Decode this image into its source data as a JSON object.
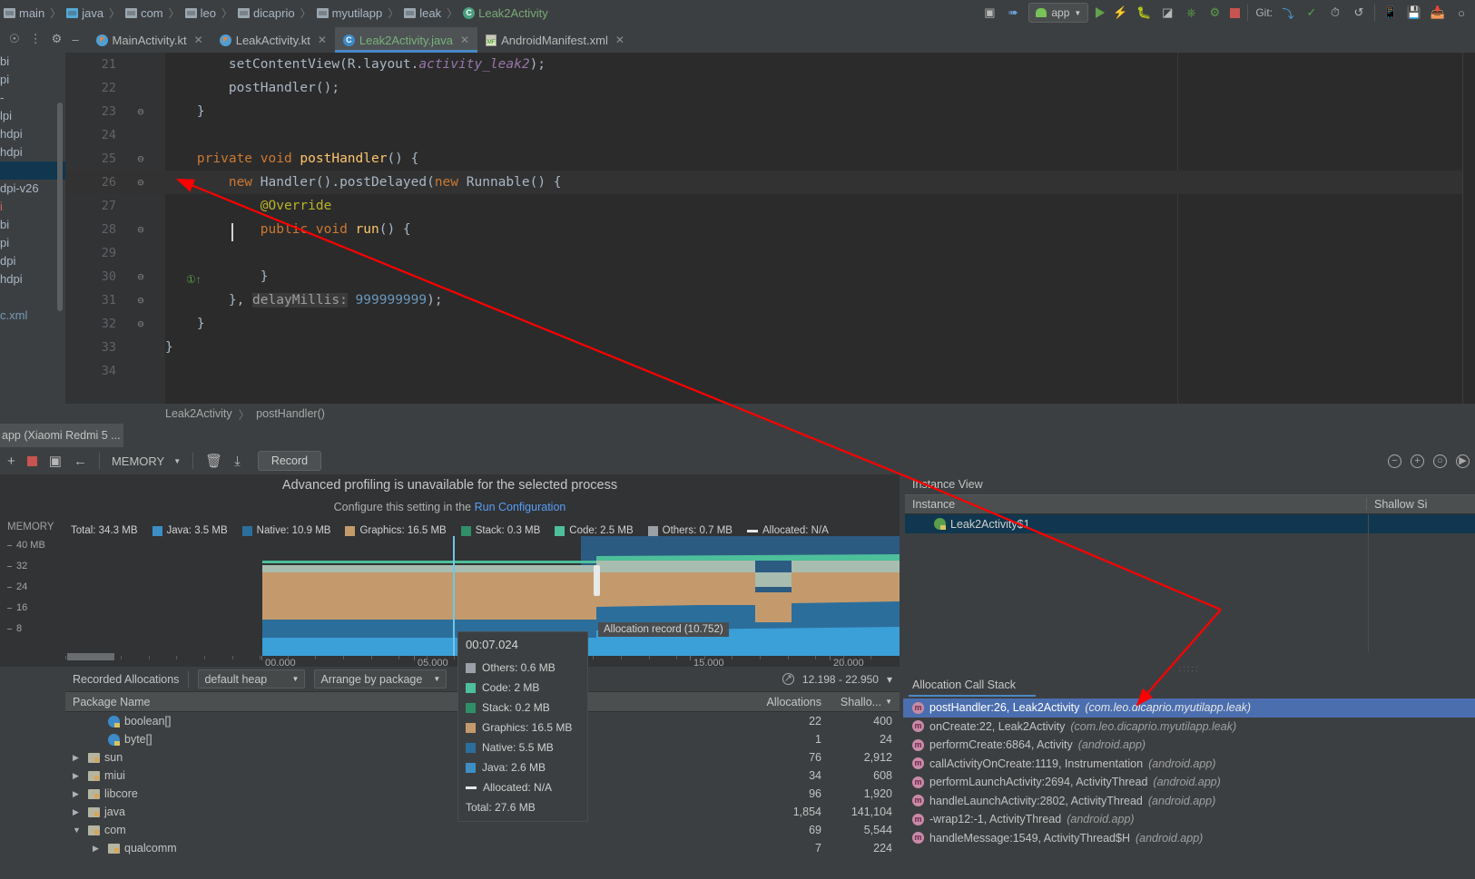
{
  "breadcrumb": {
    "items": [
      {
        "label": "main",
        "icon": "folder-icon"
      },
      {
        "label": "java",
        "icon": "folder-blue-icon"
      },
      {
        "label": "com",
        "icon": "folder-icon"
      },
      {
        "label": "leo",
        "icon": "folder-icon"
      },
      {
        "label": "dicaprio",
        "icon": "folder-icon"
      },
      {
        "label": "myutilapp",
        "icon": "folder-icon"
      },
      {
        "label": "leak",
        "icon": "folder-icon"
      },
      {
        "label": "Leak2Activity",
        "icon": "class-icon"
      }
    ],
    "separator": "〉"
  },
  "top_toolbar": {
    "app_config": "app",
    "git_label": "Git:",
    "icons": [
      "open-tool-window-icon",
      "build-hammer-icon",
      "run-icon",
      "apply-changes-icon",
      "debug-icon",
      "attach-debugger-icon",
      "profile-icon",
      "run-with-coverage-icon",
      "stop-icon",
      "update-project-icon",
      "commit-icon",
      "history-icon",
      "undo-icon",
      "avd-manager-icon",
      "sdk-manager-icon",
      "device-file-explorer-icon",
      "search-icon"
    ]
  },
  "editor_tabs": [
    {
      "label": "MainActivity.kt",
      "icon": "kotlin-file-icon",
      "active": false
    },
    {
      "label": "LeakActivity.kt",
      "icon": "kotlin-file-icon",
      "active": false
    },
    {
      "label": "Leak2Activity.java",
      "icon": "java-class-icon",
      "active": true
    },
    {
      "label": "AndroidManifest.xml",
      "icon": "manifest-file-icon",
      "active": false
    }
  ],
  "project_strip": {
    "rows": [
      "bi",
      "pi",
      "-",
      "lpi",
      "hdpi",
      "hdpi",
      "",
      "dpi-v26",
      "i",
      "bi",
      "pi",
      "dpi",
      "hdpi",
      "",
      "c.xml"
    ],
    "selected_index": 6
  },
  "code": {
    "lines": [
      {
        "num": "21",
        "fold": "",
        "html": "        <span class=\"txt\">setContentView(R.</span><span class=\"txt\">layout.</span><span class=\"fld\">activity_leak2</span><span class=\"txt\">);</span>"
      },
      {
        "num": "22",
        "fold": "",
        "html": "        <span class=\"txt\">postHandler();</span>"
      },
      {
        "num": "23",
        "fold": "⊖",
        "html": "    <span class=\"txt\">}</span>"
      },
      {
        "num": "24",
        "fold": "",
        "html": ""
      },
      {
        "num": "25",
        "fold": "⊖",
        "html": "    <span class=\"kw\">private void </span><span class=\"fn\">postHandler</span><span class=\"txt\">() {</span>"
      },
      {
        "num": "26",
        "fold": "⊖",
        "html": "        <span class=\"kw\">new </span><span class=\"txt\">Handler().postDelayed(</span><span class=\"kw\">new </span><span class=\"txt\">Runnable() {</span>",
        "current": true
      },
      {
        "num": "27",
        "fold": "",
        "html": "            <span class=\"ann\">@Override</span>"
      },
      {
        "num": "28",
        "fold": "⊖",
        "html": "            <span class=\"kw\">public void </span><span class=\"fn\">run</span><span class=\"txt\">() {</span>"
      },
      {
        "num": "29",
        "fold": "",
        "html": ""
      },
      {
        "num": "30",
        "fold": "⊖",
        "html": "            <span class=\"txt\">}</span>"
      },
      {
        "num": "31",
        "fold": "⊖",
        "html": "        <span class=\"txt\">}, </span><span class=\"param\">delayMillis:</span><span class=\"txt\"> </span><span class=\"num\">999999999</span><span class=\"txt\">);</span>"
      },
      {
        "num": "32",
        "fold": "⊖",
        "html": "    <span class=\"txt\">}</span>"
      },
      {
        "num": "33",
        "fold": "",
        "html": "<span class=\"txt\">}</span>"
      },
      {
        "num": "34",
        "fold": "",
        "html": ""
      }
    ]
  },
  "editor_breadcrumb": {
    "class": "Leak2Activity",
    "method": "postHandler()",
    "separator": "〉"
  },
  "profiler": {
    "process_tab": "app (Xiaomi Redmi 5 ...",
    "back_icon": "back-arrow-icon",
    "mode": "MEMORY",
    "record_button": "Record",
    "trash_icon": "trash-icon",
    "export_icon": "export-capture-icon",
    "add_icon": "add-icon",
    "stop_icon": "stop-icon",
    "window_icon": "split-icon",
    "zoom_out_icon": "zoom-out-icon",
    "zoom_in_icon": "zoom-in-icon",
    "reset_zoom_icon": "reset-zoom-icon",
    "attach-live-icon": "attach-to-live-icon"
  },
  "memory": {
    "advanced_message": "Advanced profiling is unavailable for the selected process",
    "configure_prefix": "Configure this setting in the ",
    "configure_link": "Run Configuration",
    "axis_title": "MEMORY",
    "legend": [
      {
        "label": "Total: 34.3 MB",
        "color": "",
        "type": "text"
      },
      {
        "label": "Java: 3.5 MB",
        "color": "#3b8fc4",
        "type": "swatch"
      },
      {
        "label": "Native: 10.9 MB",
        "color": "#2c6e9b",
        "type": "swatch"
      },
      {
        "label": "Graphics: 16.5 MB",
        "color": "#c49a6c",
        "type": "swatch"
      },
      {
        "label": "Stack: 0.3 MB",
        "color": "#2f8f68",
        "type": "swatch"
      },
      {
        "label": "Code: 2.5 MB",
        "color": "#4dbf9a",
        "type": "swatch"
      },
      {
        "label": "Others: 0.7 MB",
        "color": "#9aa0a6",
        "type": "swatch"
      },
      {
        "label": "Allocated: N/A",
        "color": "#e6e6e6",
        "type": "dash"
      }
    ],
    "allocation_record": "Allocation record (10.752)"
  },
  "chart_data": {
    "type": "area",
    "title": "MEMORY",
    "ylabel": "MB",
    "xlabel": "",
    "ylim": [
      0,
      44
    ],
    "yticks": [
      "40 MB",
      "32",
      "24",
      "16",
      "8"
    ],
    "ytick_values": [
      40,
      32,
      24,
      16,
      8
    ],
    "xticks": [
      "00.000",
      "05.000",
      "15.000",
      "20.000"
    ],
    "xtick_values": [
      0,
      5,
      15,
      20
    ],
    "xlim": [
      -1.5,
      22.95
    ],
    "grid": false,
    "legend_position": "top",
    "series": [
      {
        "name": "Java",
        "color": "#3b8fc4",
        "value_mb": 3.5
      },
      {
        "name": "Native",
        "color": "#2c6e9b",
        "value_mb": 10.9
      },
      {
        "name": "Graphics",
        "color": "#c49a6c",
        "value_mb": 16.5
      },
      {
        "name": "Stack",
        "color": "#2f8f68",
        "value_mb": 0.3
      },
      {
        "name": "Code",
        "color": "#4dbf9a",
        "value_mb": 2.5
      },
      {
        "name": "Others",
        "color": "#9aa0a6",
        "value_mb": 0.7
      },
      {
        "name": "Allocated",
        "color": "#e6e6e6",
        "value_mb": null
      }
    ],
    "total_mb": 34.3,
    "selection_range": "12.198 - 22.950",
    "hover_point": {
      "time": "00:07.024",
      "values": [
        {
          "name": "Others",
          "value": "0.6 MB",
          "color": "#9aa0a6"
        },
        {
          "name": "Code",
          "value": "2 MB",
          "color": "#4dbf9a"
        },
        {
          "name": "Stack",
          "value": "0.2 MB",
          "color": "#2f8f68"
        },
        {
          "name": "Graphics",
          "value": "16.5 MB",
          "color": "#c49a6c"
        },
        {
          "name": "Native",
          "value": "5.5 MB",
          "color": "#2c6e9b"
        },
        {
          "name": "Java",
          "value": "2.6 MB",
          "color": "#3b8fc4"
        },
        {
          "name": "Allocated",
          "value": "N/A",
          "color": "#e6e6e6"
        }
      ],
      "total": "Total: 27.6 MB"
    }
  },
  "tooltip": {
    "time": "00:07.024",
    "rows": [
      {
        "label": "Others: 0.6 MB",
        "color": "#9aa0a6",
        "type": "swatch"
      },
      {
        "label": "Code: 2 MB",
        "color": "#4dbf9a",
        "type": "swatch"
      },
      {
        "label": "Stack: 0.2 MB",
        "color": "#2f8f68",
        "type": "swatch"
      },
      {
        "label": "Graphics: 16.5 MB",
        "color": "#c49a6c",
        "type": "swatch"
      },
      {
        "label": "Native: 5.5 MB",
        "color": "#2c6e9b",
        "type": "swatch"
      },
      {
        "label": "Java: 2.6 MB",
        "color": "#3b8fc4",
        "type": "swatch"
      },
      {
        "label": "Allocated: N/A",
        "color": "#e6e6e6",
        "type": "dash"
      }
    ],
    "total": "Total: 27.6 MB"
  },
  "allocations": {
    "title": "Recorded Allocations",
    "heap_select": "default heap",
    "arrange_select": "Arrange by package",
    "time_range": "12.198 - 22.950",
    "clock_icon": "clock-icon",
    "filter_icon": "filter-icon",
    "columns": [
      "Package Name",
      "Allocations",
      "Shallo..."
    ],
    "rows": [
      {
        "name": "boolean[]",
        "icon": "class-icon",
        "expand": "",
        "indent": true,
        "allocations": "22",
        "shallow": "400"
      },
      {
        "name": "byte[]",
        "icon": "class-icon",
        "expand": "",
        "indent": true,
        "allocations": "1",
        "shallow": "24"
      },
      {
        "name": "sun",
        "icon": "package-icon",
        "expand": "▶",
        "indent": false,
        "allocations": "76",
        "shallow": "2,912"
      },
      {
        "name": "miui",
        "icon": "package-icon",
        "expand": "▶",
        "indent": false,
        "allocations": "34",
        "shallow": "608"
      },
      {
        "name": "libcore",
        "icon": "package-icon",
        "expand": "▶",
        "indent": false,
        "allocations": "96",
        "shallow": "1,920"
      },
      {
        "name": "java",
        "icon": "package-icon",
        "expand": "▶",
        "indent": false,
        "allocations": "1,854",
        "shallow": "141,104"
      },
      {
        "name": "com",
        "icon": "package-icon",
        "expand": "▼",
        "indent": false,
        "allocations": "69",
        "shallow": "5,544"
      },
      {
        "name": "qualcomm",
        "icon": "package-icon",
        "expand": "▶",
        "indent": true,
        "allocations": "7",
        "shallow": "224"
      }
    ]
  },
  "instance_view": {
    "title": "Instance View",
    "columns": [
      "Instance",
      "Shallow Si"
    ],
    "rows": [
      {
        "name": "Leak2Activity$1",
        "icon": "instance-icon",
        "selected": true
      }
    ]
  },
  "call_stack": {
    "tab": "Allocation Call Stack",
    "frames": [
      {
        "method": "postHandler:26, Leak2Activity",
        "package": "(com.leo.dicaprio.myutilapp.leak)",
        "selected": true
      },
      {
        "method": "onCreate:22, Leak2Activity",
        "package": "(com.leo.dicaprio.myutilapp.leak)",
        "selected": false
      },
      {
        "method": "performCreate:6864, Activity",
        "package": "(android.app)",
        "selected": false
      },
      {
        "method": "callActivityOnCreate:1119, Instrumentation",
        "package": "(android.app)",
        "selected": false
      },
      {
        "method": "performLaunchActivity:2694, ActivityThread",
        "package": "(android.app)",
        "selected": false
      },
      {
        "method": "handleLaunchActivity:2802, ActivityThread",
        "package": "(android.app)",
        "selected": false
      },
      {
        "method": "-wrap12:-1, ActivityThread",
        "package": "(android.app)",
        "selected": false
      },
      {
        "method": "handleMessage:1549, ActivityThread$H",
        "package": "(android.app)",
        "selected": false
      }
    ]
  },
  "annotation": {
    "arrow_color": "#ff0000"
  }
}
